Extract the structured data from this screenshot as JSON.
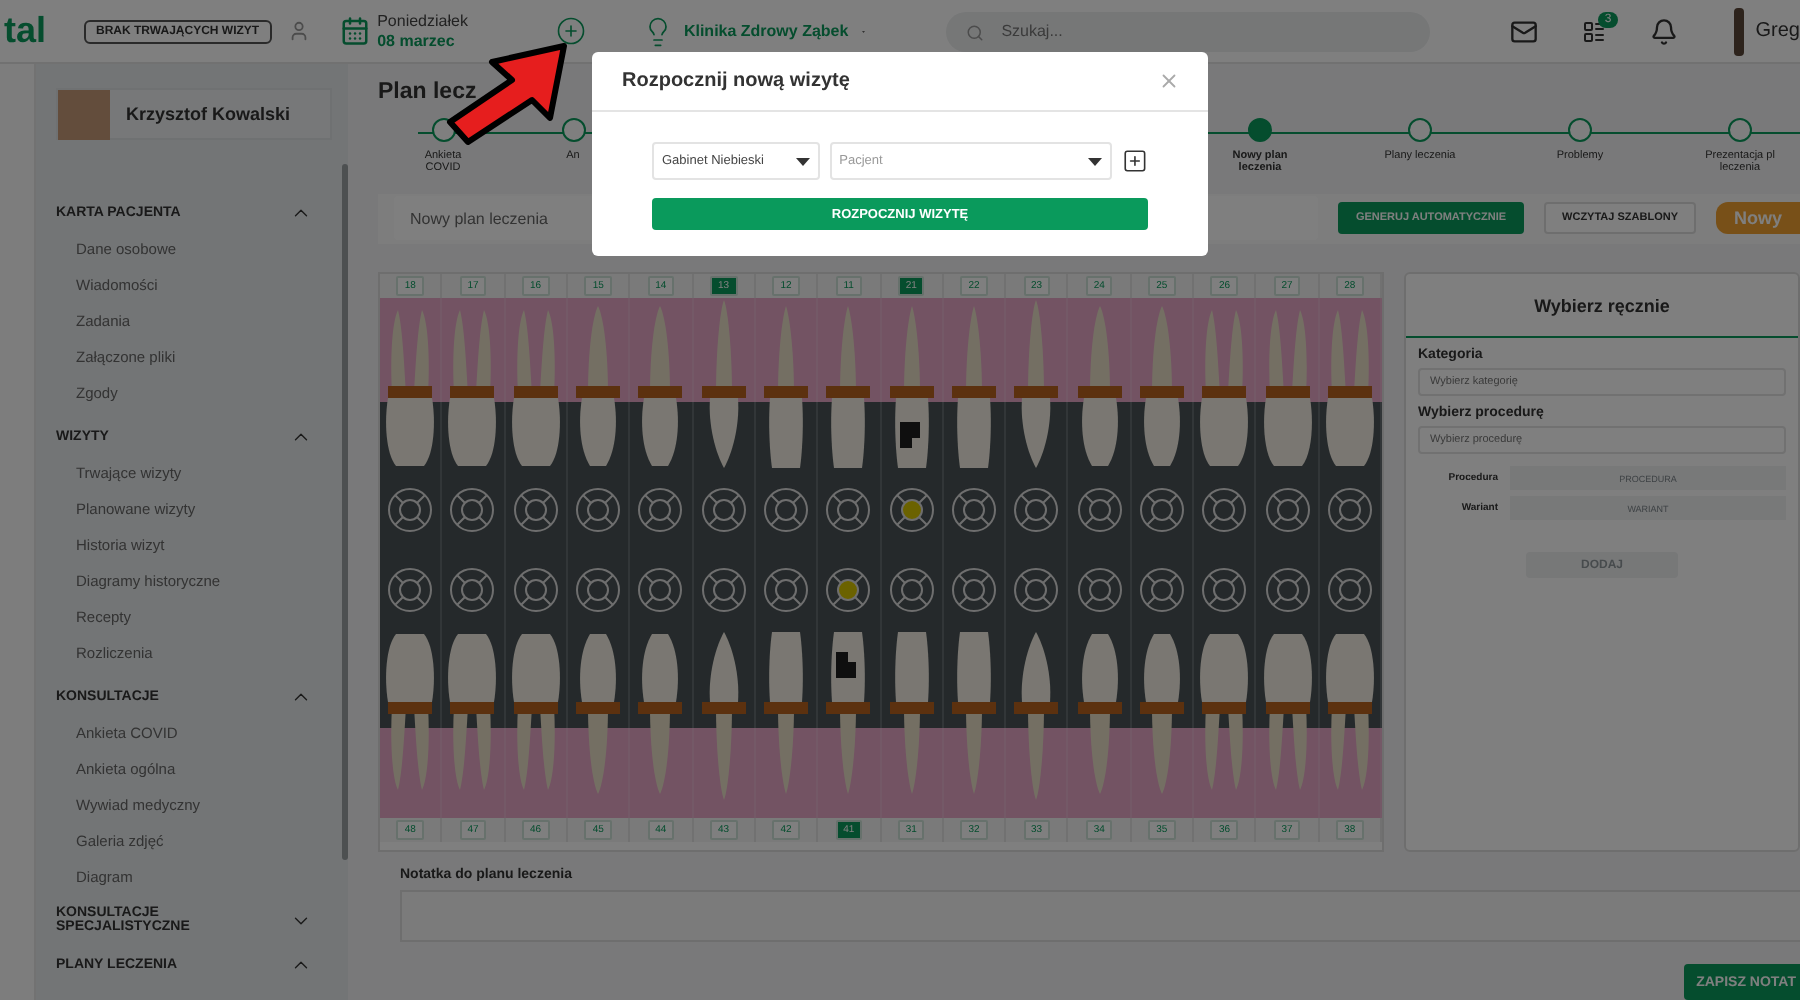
{
  "header": {
    "logo": "tal",
    "visit_status": "BRAK TRWAJĄCYCH WIZYT",
    "date": {
      "weekday": "Poniedziałek",
      "day": "08 marzec"
    },
    "clinic": "Klinika Zdrowy Ząbek",
    "search": {
      "placeholder": "Szukaj..."
    },
    "notifications_count": "3",
    "user_name": "Greg"
  },
  "sidebar": {
    "patient_name": "Krzysztof Kowalski",
    "sections": [
      {
        "title": "KARTA PACJENTA",
        "expanded": true,
        "items": [
          "Dane osobowe",
          "Wiadomości",
          "Zadania",
          "Załączone pliki",
          "Zgody"
        ]
      },
      {
        "title": "WIZYTY",
        "expanded": true,
        "items": [
          "Trwające wizyty",
          "Planowane wizyty",
          "Historia wizyt",
          "Diagramy historyczne",
          "Recepty",
          "Rozliczenia"
        ]
      },
      {
        "title": "KONSULTACJE",
        "expanded": true,
        "items": [
          "Ankieta COVID",
          "Ankieta ogólna",
          "Wywiad medyczny",
          "Galeria zdjęć",
          "Diagram"
        ]
      },
      {
        "title": "KONSULTACJE SPECJALISTYCZNE",
        "expanded": false
      },
      {
        "title": "PLANY LECZENIA",
        "expanded": true
      }
    ]
  },
  "page": {
    "title": "Plan lecz",
    "steps_left": [
      {
        "label": "Ankieta COVID",
        "selected": false
      },
      {
        "label": "An",
        "selected": false
      }
    ],
    "steps_right": [
      {
        "label": "Nowy plan leczenia",
        "selected": true
      },
      {
        "label": "Plany leczenia",
        "selected": false
      },
      {
        "label": "Problemy",
        "selected": false
      },
      {
        "label": "Prezentacja pl leczenia",
        "selected": false
      }
    ],
    "plan_name": {
      "value": "Nowy plan leczenia"
    },
    "buttons": [
      {
        "label": "GENERUJ AUTOMATYCZNIE",
        "kind": "primary"
      },
      {
        "label": "WCZYTAJ SZABLONY",
        "kind": "outline"
      },
      {
        "label": "Nowy",
        "kind": "badge"
      }
    ]
  },
  "chart": {
    "upper": [
      {
        "number": "18",
        "selected": false,
        "treated": false
      },
      {
        "number": "17",
        "selected": false,
        "treated": false
      },
      {
        "number": "16",
        "selected": false,
        "treated": false
      },
      {
        "number": "15",
        "selected": false,
        "treated": false
      },
      {
        "number": "14",
        "selected": false,
        "treated": false
      },
      {
        "number": "13",
        "selected": true,
        "treated": false
      },
      {
        "number": "12",
        "selected": false,
        "treated": false
      },
      {
        "number": "11",
        "selected": false,
        "treated": false
      },
      {
        "number": "21",
        "selected": true,
        "treated": true
      },
      {
        "number": "22",
        "selected": false,
        "treated": false
      },
      {
        "number": "23",
        "selected": false,
        "treated": false
      },
      {
        "number": "24",
        "selected": false,
        "treated": false
      },
      {
        "number": "25",
        "selected": false,
        "treated": false
      },
      {
        "number": "26",
        "selected": false,
        "treated": false
      },
      {
        "number": "27",
        "selected": false,
        "treated": false
      },
      {
        "number": "28",
        "selected": false,
        "treated": false
      }
    ],
    "lower": [
      {
        "number": "48",
        "selected": false,
        "treated": false
      },
      {
        "number": "47",
        "selected": false,
        "treated": false
      },
      {
        "number": "46",
        "selected": false,
        "treated": false
      },
      {
        "number": "45",
        "selected": false,
        "treated": false
      },
      {
        "number": "44",
        "selected": false,
        "treated": false
      },
      {
        "number": "43",
        "selected": false,
        "treated": false
      },
      {
        "number": "42",
        "selected": false,
        "treated": false
      },
      {
        "number": "41",
        "selected": true,
        "treated": true
      },
      {
        "number": "31",
        "selected": false,
        "treated": false
      },
      {
        "number": "32",
        "selected": false,
        "treated": false
      },
      {
        "number": "33",
        "selected": false,
        "treated": false
      },
      {
        "number": "34",
        "selected": false,
        "treated": false
      },
      {
        "number": "35",
        "selected": false,
        "treated": false
      },
      {
        "number": "36",
        "selected": false,
        "treated": false
      },
      {
        "number": "37",
        "selected": false,
        "treated": false
      },
      {
        "number": "38",
        "selected": false,
        "treated": false
      }
    ]
  },
  "manual_panel": {
    "title": "Wybierz ręcznie",
    "category": {
      "label": "Kategoria",
      "placeholder": "Wybierz kategorię"
    },
    "procedure": {
      "label": "Wybierz procedurę",
      "placeholder": "Wybierz procedurę"
    },
    "rows": [
      {
        "label": "Procedura",
        "placeholder": "PROCEDURA",
        "disabled": true
      },
      {
        "label": "Wariant",
        "placeholder": "WARIANT",
        "disabled": true
      }
    ],
    "add_button": {
      "label": "DODAJ",
      "disabled": true
    }
  },
  "note": {
    "label": "Notatka do planu leczenia",
    "button": "ZAPISZ NOTAT"
  },
  "modal": {
    "title": "Rozpocznij nową wizytę",
    "room": "Gabinet Niebieski",
    "patient_placeholder": "Pacjent",
    "start_button": "ROZPOCZNIJ WIZYTĘ"
  }
}
